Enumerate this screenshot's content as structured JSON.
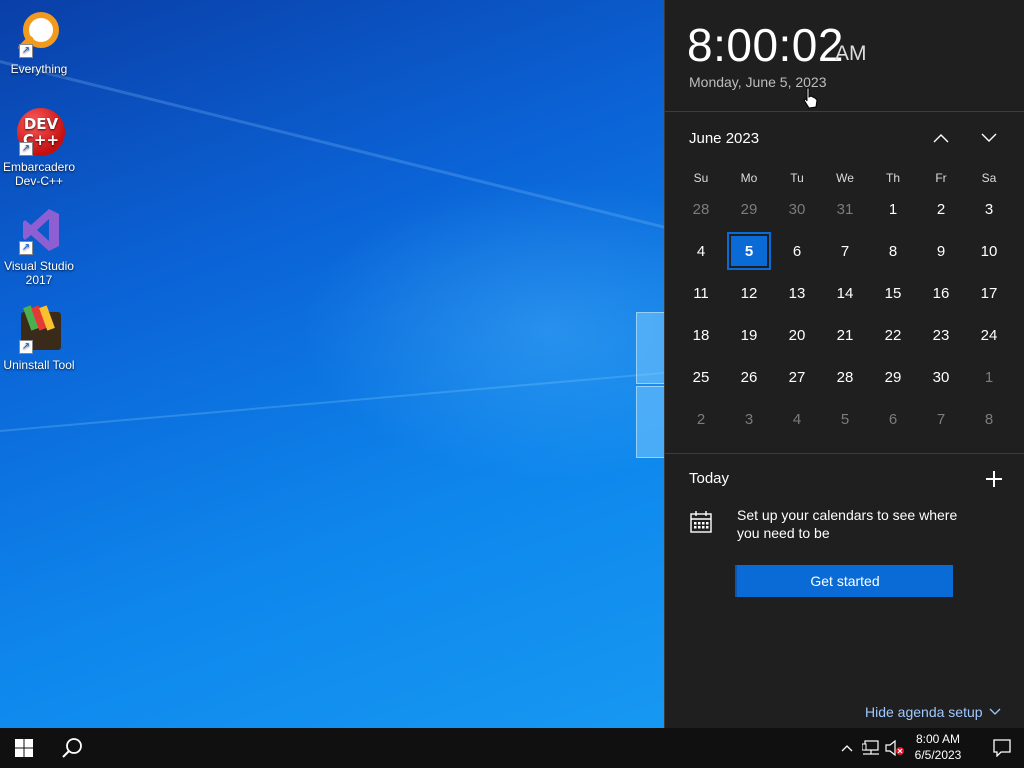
{
  "desktop": {
    "icons": [
      {
        "label": "Everything"
      },
      {
        "label": "Embarcadero Dev-C++"
      },
      {
        "label": "Visual Studio 2017"
      },
      {
        "label": "Uninstall Tool"
      }
    ]
  },
  "flyout": {
    "time": "8:00:02",
    "ampm": "AM",
    "date": "Monday, June 5, 2023",
    "month_label": "June 2023",
    "weekdays": [
      "Su",
      "Mo",
      "Tu",
      "We",
      "Th",
      "Fr",
      "Sa"
    ],
    "weeks": [
      [
        "28",
        "29",
        "30",
        "31",
        "1",
        "2",
        "3"
      ],
      [
        "4",
        "5",
        "6",
        "7",
        "8",
        "9",
        "10"
      ],
      [
        "11",
        "12",
        "13",
        "14",
        "15",
        "16",
        "17"
      ],
      [
        "18",
        "19",
        "20",
        "21",
        "22",
        "23",
        "24"
      ],
      [
        "25",
        "26",
        "27",
        "28",
        "29",
        "30",
        "1"
      ],
      [
        "2",
        "3",
        "4",
        "5",
        "6",
        "7",
        "8"
      ]
    ],
    "today_label": "Today",
    "setup_text": "Set up your calendars to see where you need to be",
    "get_started": "Get started",
    "hide_agenda": "Hide agenda setup"
  },
  "taskbar": {
    "time": "8:00 AM",
    "date": "6/5/2023"
  },
  "colors": {
    "accent": "#0b6bd6",
    "flyout_bg": "#1f1f1f",
    "taskbar_bg": "#101010",
    "link": "#9fc8ff"
  },
  "icons": [
    "windows-start-icon",
    "search-icon",
    "chevron-up-icon",
    "chevron-down-icon",
    "plus-icon",
    "calendar-icon",
    "network-icon",
    "volume-muted-icon",
    "notification-icon",
    "mouse-cursor-icon"
  ]
}
